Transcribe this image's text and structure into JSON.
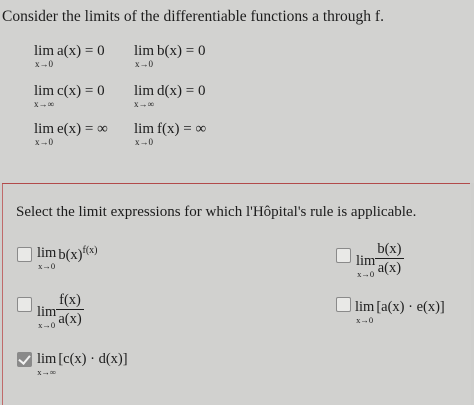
{
  "intro_text": "Consider the limits of the differentiable functions a through f.",
  "given_limits": [
    {
      "lim": "lim",
      "sub": "x→0",
      "expr": "a(x) = 0"
    },
    {
      "lim": "lim",
      "sub": "x→0",
      "expr": "b(x) = 0"
    },
    {
      "lim": "lim",
      "sub": "x→∞",
      "expr": "c(x) = 0"
    },
    {
      "lim": "lim",
      "sub": "x→∞",
      "expr": "d(x) = 0"
    },
    {
      "lim": "lim",
      "sub": "x→0",
      "expr": "e(x) = ∞"
    },
    {
      "lim": "lim",
      "sub": "x→0",
      "expr": "f(x) = ∞"
    }
  ],
  "question": "Select the limit expressions for which l'Hôpital's rule is applicable.",
  "options": [
    {
      "lim": "lim",
      "sub": "x→0",
      "base": "b(x)",
      "exp": "f(x)",
      "checked": false
    },
    {
      "lim": "lim",
      "sub": "x→0",
      "num": "b(x)",
      "den": "a(x)",
      "checked": false
    },
    {
      "lim": "lim",
      "sub": "x→0",
      "num": "f(x)",
      "den": "a(x)",
      "checked": false
    },
    {
      "lim": "lim",
      "sub": "x→0",
      "expr": "[a(x) · e(x)]",
      "checked": false
    },
    {
      "lim": "lim",
      "sub": "x→∞",
      "expr": "[c(x) · d(x)]",
      "checked": true
    }
  ]
}
